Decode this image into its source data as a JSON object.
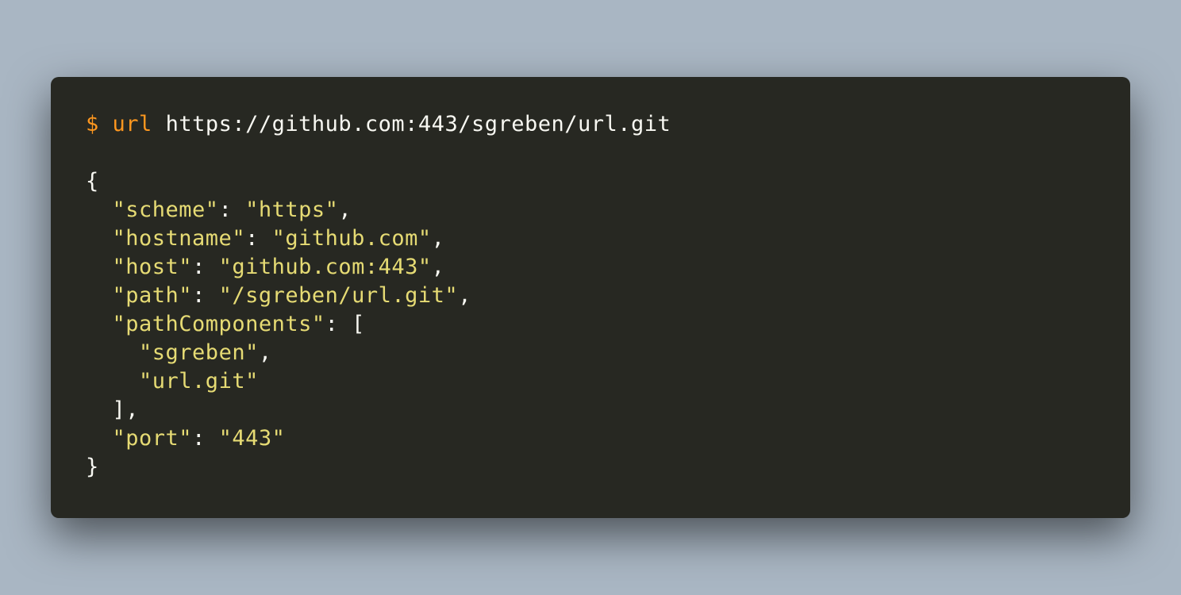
{
  "terminal": {
    "command": {
      "prompt": "$",
      "program": "url",
      "argument": "https://github.com:443/sgreben/url.git"
    },
    "output": {
      "open_brace": "{",
      "close_brace": "}",
      "scheme": {
        "key": "\"scheme\"",
        "value": "\"https\""
      },
      "hostname": {
        "key": "\"hostname\"",
        "value": "\"github.com\""
      },
      "host": {
        "key": "\"host\"",
        "value": "\"github.com:443\""
      },
      "path": {
        "key": "\"path\"",
        "value": "\"/sgreben/url.git\""
      },
      "pathComponents": {
        "key": "\"pathComponents\"",
        "open": "[",
        "close": "],",
        "items": [
          "\"sgreben\"",
          "\"url.git\""
        ]
      },
      "port": {
        "key": "\"port\"",
        "value": "\"443\""
      }
    }
  },
  "colors": {
    "background": "#a9b6c3",
    "terminal_bg": "#272822",
    "prompt": "#fd971f",
    "string": "#e6db74",
    "text": "#f8f8f2"
  }
}
